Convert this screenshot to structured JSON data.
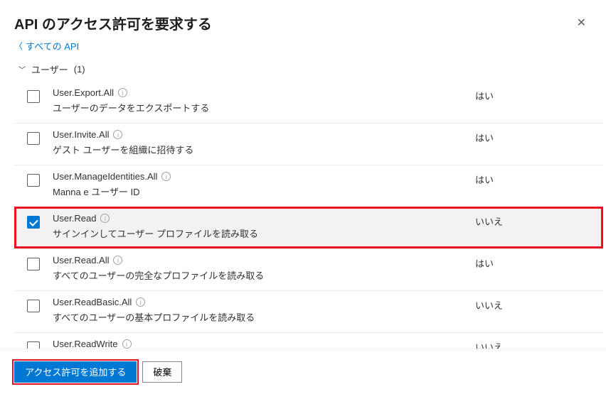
{
  "header": {
    "title": "API のアクセス許可を要求する"
  },
  "backLink": "すべての API",
  "group": {
    "label": "ユーザー",
    "count": "(1)"
  },
  "adminConsent": {
    "yes": "はい",
    "no": "いいえ"
  },
  "permissions": [
    {
      "name": "User.Export.All",
      "desc": "ユーザーのデータをエクスポートする",
      "admin": "yes",
      "checked": false,
      "highlight": false
    },
    {
      "name": "User.Invite.All",
      "desc": "ゲスト ユーザーを組織に招待する",
      "admin": "yes",
      "checked": false,
      "highlight": false
    },
    {
      "name": "User.ManageIdentities.All",
      "desc": "Manna e ユーザー ID",
      "admin": "yes",
      "checked": false,
      "highlight": false
    },
    {
      "name": "User.Read",
      "desc": "サインインしてユーザー プロファイルを読み取る",
      "admin": "no",
      "checked": true,
      "highlight": true
    },
    {
      "name": "User.Read.All",
      "desc": "すべてのユーザーの完全なプロファイルを読み取る",
      "admin": "yes",
      "checked": false,
      "highlight": false
    },
    {
      "name": "User.ReadBasic.All",
      "desc": "すべてのユーザーの基本プロファイルを読み取る",
      "admin": "no",
      "checked": false,
      "highlight": false
    },
    {
      "name": "User.ReadWrite",
      "desc": "",
      "admin": "no",
      "checked": false,
      "highlight": false
    }
  ],
  "footer": {
    "add": "アクセス許可を追加する",
    "discard": "破棄"
  }
}
